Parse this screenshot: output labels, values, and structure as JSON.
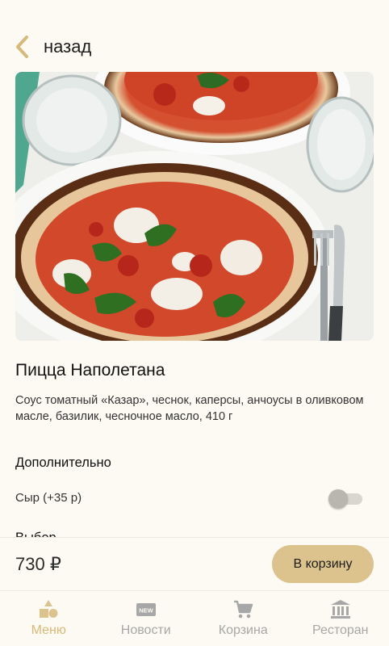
{
  "header": {
    "back_label": "назад"
  },
  "product": {
    "title": "Пицца Наполетана",
    "description": "Соус томатный «Казар», чеснок, каперсы, анчоусы в оливковом масле, базилик, чесночное масло, 410 г"
  },
  "extras": {
    "section_title": "Дополнительно",
    "options": [
      {
        "label": "Сыр (+35 р)",
        "enabled": false
      }
    ],
    "next_section_title": "Выбор"
  },
  "checkout": {
    "price": "730 ₽",
    "add_to_cart_label": "В корзину"
  },
  "bottom_nav": {
    "items": [
      {
        "label": "Меню",
        "icon": "menu-shapes-icon",
        "active": true
      },
      {
        "label": "Новости",
        "icon": "new-badge-icon",
        "active": false
      },
      {
        "label": "Корзина",
        "icon": "cart-icon",
        "active": false
      },
      {
        "label": "Ресторан",
        "icon": "building-icon",
        "active": false
      }
    ]
  },
  "colors": {
    "accent": "#dcc38e",
    "accent_text": "#d9b978",
    "background": "#fdfaf3",
    "inactive": "#a7a7a7"
  }
}
